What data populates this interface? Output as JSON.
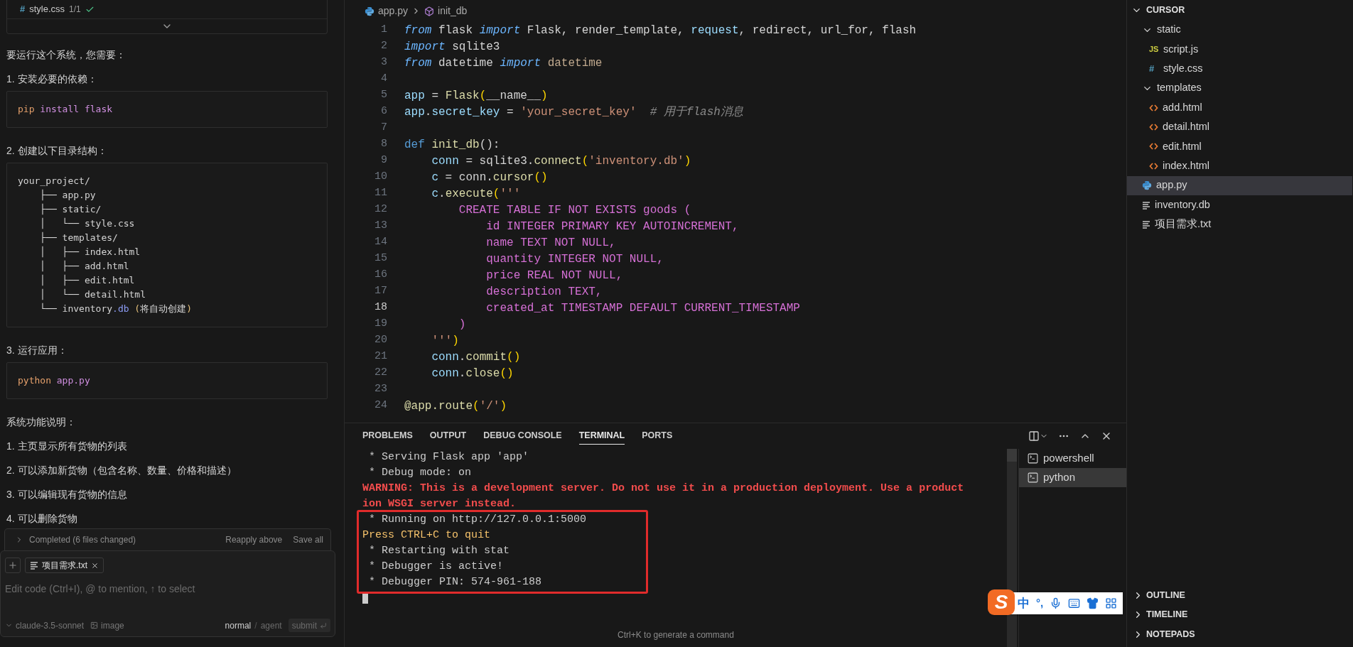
{
  "chat": {
    "file_card": {
      "glyph": "#",
      "name": "style.css",
      "count": "1/1"
    },
    "blocks": [
      {
        "kind": "text",
        "text": "要运行这个系统，您需要："
      },
      {
        "kind": "text",
        "text": "1. 安装必要的依赖："
      },
      {
        "kind": "code",
        "lines": [
          [
            {
              "text": "pip",
              "kind": "o"
            },
            {
              "text": " install flask",
              "kind": "q"
            }
          ]
        ]
      },
      {
        "kind": "text",
        "text": "2. 创建以下目录结构："
      },
      {
        "kind": "code",
        "lines": [
          [
            {
              "text": "your_project/",
              "kind": "t"
            }
          ],
          [
            {
              "text": "    ├── app.py",
              "kind": "t"
            }
          ],
          [
            {
              "text": "    ├── static/",
              "kind": "t"
            }
          ],
          [
            {
              "text": "    │   └── style.css",
              "kind": "t"
            }
          ],
          [
            {
              "text": "    ├── templates/",
              "kind": "t"
            }
          ],
          [
            {
              "text": "    │   ├── index.html",
              "kind": "t"
            }
          ],
          [
            {
              "text": "    │   ├── add.html",
              "kind": "t"
            }
          ],
          [
            {
              "text": "    │   ├── edit.html",
              "kind": "t"
            }
          ],
          [
            {
              "text": "    │   └── detail.html",
              "kind": "t"
            }
          ],
          [
            {
              "text": "    └── inventory",
              "kind": "t"
            },
            {
              "text": ".db",
              "kind": "b"
            },
            {
              "text": " (",
              "kind": "y"
            },
            {
              "text": "将自动创建",
              "kind": "t"
            },
            {
              "text": ")",
              "kind": "y"
            }
          ]
        ]
      },
      {
        "kind": "text",
        "text": "3. 运行应用："
      },
      {
        "kind": "code",
        "lines": [
          [
            {
              "text": "python",
              "kind": "o"
            },
            {
              "text": " app.py",
              "kind": "q"
            }
          ]
        ]
      },
      {
        "kind": "text",
        "text": "系统功能说明："
      },
      {
        "kind": "text",
        "text": "1. 主页显示所有货物的列表"
      },
      {
        "kind": "text",
        "text": "2. 可以添加新货物（包含名称、数量、价格和描述）"
      },
      {
        "kind": "text",
        "text": "3. 可以编辑现有货物的信息"
      },
      {
        "kind": "text",
        "text": "4. 可以删除货物"
      }
    ],
    "status": {
      "label": "Completed (6 files changed)",
      "actions": [
        "Reapply above",
        "Save all"
      ]
    },
    "composer": {
      "chip": "项目需求.txt",
      "placeholder": "Edit code (Ctrl+I), @ to mention, ↑ to select",
      "model": "claude-3.5-sonnet",
      "image": "image",
      "modes": [
        {
          "label": "normal",
          "selected": true
        },
        {
          "label": "agent",
          "selected": false
        }
      ],
      "separator": "/",
      "submit": "submit"
    }
  },
  "editor": {
    "breadcrumb": [
      "app.py",
      "init_db"
    ],
    "lines": [
      {
        "n": "1",
        "current": false,
        "tokens": [
          {
            "text": "from",
            "kind": "k"
          },
          {
            "text": " flask ",
            "kind": "t"
          },
          {
            "text": "import",
            "kind": "k"
          },
          {
            "text": " Flask, render_template, ",
            "kind": "t"
          },
          {
            "text": "request",
            "kind": "v"
          },
          {
            "text": ", redirect, url_for, flash",
            "kind": "t"
          }
        ]
      },
      {
        "n": "2",
        "current": false,
        "tokens": [
          {
            "text": "import",
            "kind": "k"
          },
          {
            "text": " sqlite3",
            "kind": "t"
          }
        ]
      },
      {
        "n": "3",
        "current": false,
        "tokens": [
          {
            "text": "from",
            "kind": "k"
          },
          {
            "text": " datetime ",
            "kind": "t"
          },
          {
            "text": "import",
            "kind": "k"
          },
          {
            "text": " datetime",
            "kind": "m"
          }
        ]
      },
      {
        "n": "4",
        "current": false
      },
      {
        "n": "5",
        "current": false,
        "tokens": [
          {
            "text": "app",
            "kind": "v"
          },
          {
            "text": " = ",
            "kind": "t"
          },
          {
            "text": "Flask",
            "kind": "f"
          },
          {
            "text": "(",
            "kind": "p"
          },
          {
            "text": "__name__",
            "kind": "t"
          },
          {
            "text": ")",
            "kind": "p"
          }
        ]
      },
      {
        "n": "6",
        "current": false,
        "tokens": [
          {
            "text": "app",
            "kind": "v"
          },
          {
            "text": ".",
            "kind": "t"
          },
          {
            "text": "secret_key",
            "kind": "v"
          },
          {
            "text": " = ",
            "kind": "t"
          },
          {
            "text": "'your_secret_key'",
            "kind": "s"
          },
          {
            "text": "  # 用于flash消息",
            "kind": "c"
          }
        ]
      },
      {
        "n": "7",
        "current": false
      },
      {
        "n": "8",
        "current": false,
        "tokens": [
          {
            "text": "def",
            "kind": "d"
          },
          {
            "text": " init_db",
            "kind": "f"
          },
          {
            "text": "():",
            "kind": "t"
          }
        ]
      },
      {
        "n": "9",
        "current": false,
        "tokens": [
          {
            "text": "    conn",
            "kind": "v"
          },
          {
            "text": " = sqlite3.",
            "kind": "t"
          },
          {
            "text": "connect",
            "kind": "f"
          },
          {
            "text": "(",
            "kind": "p"
          },
          {
            "text": "'inventory.db'",
            "kind": "s"
          },
          {
            "text": ")",
            "kind": "p"
          }
        ]
      },
      {
        "n": "10",
        "current": false,
        "tokens": [
          {
            "text": "    c",
            "kind": "v"
          },
          {
            "text": " = conn.",
            "kind": "t"
          },
          {
            "text": "cursor",
            "kind": "f"
          },
          {
            "text": "()",
            "kind": "p"
          }
        ]
      },
      {
        "n": "11",
        "current": false,
        "tokens": [
          {
            "text": "    c",
            "kind": "v"
          },
          {
            "text": ".",
            "kind": "t"
          },
          {
            "text": "execute",
            "kind": "f"
          },
          {
            "text": "(",
            "kind": "p"
          },
          {
            "text": "'''",
            "kind": "s"
          }
        ]
      },
      {
        "n": "12",
        "current": false,
        "tokens": [
          {
            "text": "        CREATE TABLE IF NOT EXISTS goods (",
            "kind": "q"
          }
        ]
      },
      {
        "n": "13",
        "current": false,
        "tokens": [
          {
            "text": "            id INTEGER PRIMARY KEY AUTOINCREMENT,",
            "kind": "q"
          }
        ]
      },
      {
        "n": "14",
        "current": false,
        "tokens": [
          {
            "text": "            name TEXT NOT NULL,",
            "kind": "q"
          }
        ]
      },
      {
        "n": "15",
        "current": false,
        "tokens": [
          {
            "text": "            quantity INTEGER NOT NULL,",
            "kind": "q"
          }
        ]
      },
      {
        "n": "16",
        "current": false,
        "tokens": [
          {
            "text": "            price REAL NOT NULL,",
            "kind": "q"
          }
        ]
      },
      {
        "n": "17",
        "current": false,
        "tokens": [
          {
            "text": "            description TEXT,",
            "kind": "q"
          }
        ]
      },
      {
        "n": "18",
        "current": true,
        "tokens": [
          {
            "text": "            created_at TIMESTAMP DEFAULT CURRENT_TIMESTAMP",
            "kind": "q"
          }
        ]
      },
      {
        "n": "19",
        "current": false,
        "tokens": [
          {
            "text": "        )",
            "kind": "q"
          }
        ]
      },
      {
        "n": "20",
        "current": false,
        "tokens": [
          {
            "text": "    '''",
            "kind": "s"
          },
          {
            "text": ")",
            "kind": "p"
          }
        ]
      },
      {
        "n": "21",
        "current": false,
        "tokens": [
          {
            "text": "    conn",
            "kind": "v"
          },
          {
            "text": ".",
            "kind": "t"
          },
          {
            "text": "commit",
            "kind": "f"
          },
          {
            "text": "()",
            "kind": "p"
          }
        ]
      },
      {
        "n": "22",
        "current": false,
        "tokens": [
          {
            "text": "    conn",
            "kind": "v"
          },
          {
            "text": ".",
            "kind": "t"
          },
          {
            "text": "close",
            "kind": "f"
          },
          {
            "text": "()",
            "kind": "p"
          }
        ]
      },
      {
        "n": "23",
        "current": false
      },
      {
        "n": "24",
        "current": false,
        "tokens": [
          {
            "text": "@app.route",
            "kind": "f"
          },
          {
            "text": "(",
            "kind": "p"
          },
          {
            "text": "'/'",
            "kind": "s"
          },
          {
            "text": ")",
            "kind": "p"
          }
        ]
      }
    ]
  },
  "panel": {
    "tabs": [
      {
        "label": "PROBLEMS",
        "selected": false
      },
      {
        "label": "OUTPUT",
        "selected": false
      },
      {
        "label": "DEBUG CONSOLE",
        "selected": false
      },
      {
        "label": "TERMINAL",
        "selected": true
      },
      {
        "label": "PORTS",
        "selected": false
      }
    ],
    "terminal": [
      {
        "text": " * Serving Flask app 'app'",
        "kind": "normal"
      },
      {
        "text": " * Debug mode: on",
        "kind": "normal"
      },
      {
        "text": "WARNING: This is a development server. Do not use it in a production deployment. Use a product",
        "kind": "warning"
      },
      {
        "text": "ion WSGI server instead.",
        "kind": "warning"
      },
      {
        "text": " * Running on http://127.0.0.1:5000",
        "kind": "normal"
      },
      {
        "text": "Press CTRL+C to quit",
        "kind": "prompt"
      },
      {
        "text": " * Restarting with stat",
        "kind": "normal"
      },
      {
        "text": " * Debugger is active!",
        "kind": "normal"
      },
      {
        "text": " * Debugger PIN: 574-961-188",
        "kind": "normal"
      }
    ],
    "hint": "Ctrl+K to generate a command",
    "sessions": [
      {
        "label": "powershell",
        "selected": false
      },
      {
        "label": "python",
        "selected": true
      }
    ]
  },
  "explorer": {
    "root": {
      "label": "CURSOR",
      "kind": "folder",
      "expanded": true,
      "children": [
        {
          "label": "static",
          "kind": "folder",
          "expanded": true,
          "children": [
            {
              "label": "script.js",
              "kind": "js",
              "glyph": "JS",
              "selected": false
            },
            {
              "label": "style.css",
              "kind": "css",
              "glyph": "#",
              "selected": false
            }
          ]
        },
        {
          "label": "templates",
          "kind": "folder",
          "expanded": true,
          "children": [
            {
              "label": "add.html",
              "kind": "html",
              "selected": false
            },
            {
              "label": "detail.html",
              "kind": "html",
              "selected": false
            },
            {
              "label": "edit.html",
              "kind": "html",
              "selected": false
            },
            {
              "label": "index.html",
              "kind": "html",
              "selected": false
            }
          ]
        },
        {
          "label": "app.py",
          "kind": "py",
          "selected": true
        },
        {
          "label": "inventory.db",
          "kind": "text",
          "selected": false
        },
        {
          "label": "项目需求.txt",
          "kind": "text",
          "selected": false
        }
      ]
    },
    "sections": [
      {
        "label": "OUTLINE",
        "expanded": false
      },
      {
        "label": "TIMELINE",
        "expanded": false
      },
      {
        "label": "NOTEPADS",
        "expanded": false
      }
    ]
  },
  "ime": {
    "logo": "S",
    "mode": "中",
    "punct": "°,"
  }
}
